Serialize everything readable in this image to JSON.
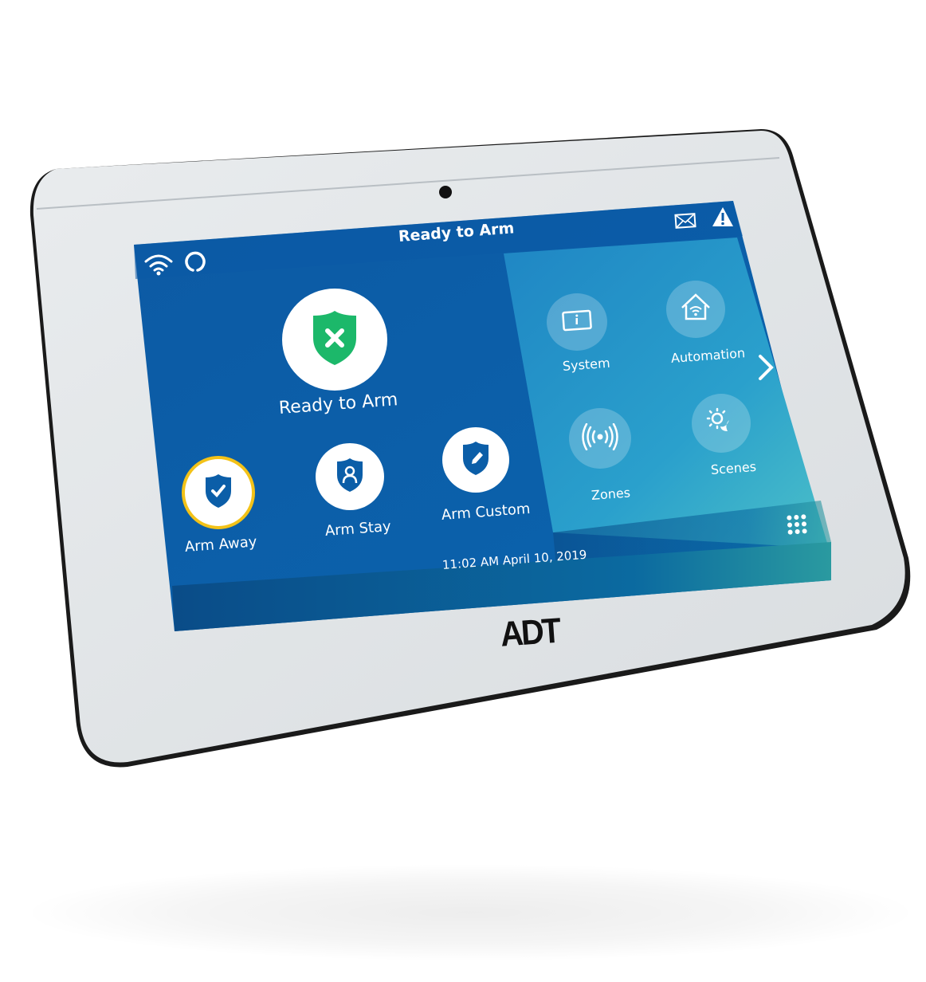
{
  "device": {
    "brand": "ADT",
    "colors": {
      "body": "#dde1e4",
      "screen_primary": "#0a5ea8",
      "screen_header": "#0b5aa6",
      "screen_right_top": "#1f88c6",
      "screen_right_bottom": "#48bcc8",
      "footer": "#0a4f8c",
      "ready_green": "#1cb86a",
      "arm_away_ring": "#f3c218",
      "shield_blue": "#0b5ea8"
    }
  },
  "status_bar": {
    "title": "Ready to Arm",
    "left_icons": [
      "wifi-icon",
      "alexa-ring-icon"
    ],
    "right_icons": [
      "mail-icon",
      "alert-triangle-icon"
    ]
  },
  "main": {
    "status_label": "Ready to Arm",
    "status_icon": "shield-x-icon",
    "arm_buttons": [
      {
        "label": "Arm Away",
        "icon": "shield-check-icon",
        "selected": true
      },
      {
        "label": "Arm Stay",
        "icon": "shield-person-icon",
        "selected": false
      },
      {
        "label": "Arm Custom",
        "icon": "shield-pencil-icon",
        "selected": false
      }
    ]
  },
  "menu": {
    "tiles": [
      {
        "label": "System",
        "icon": "info-panel-icon"
      },
      {
        "label": "Automation",
        "icon": "smart-home-icon"
      },
      {
        "label": "Zones",
        "icon": "sensor-signal-icon"
      },
      {
        "label": "Scenes",
        "icon": "sun-moon-icon"
      }
    ],
    "next_icon": "chevron-right-icon",
    "keypad_icon": "keypad-icon"
  },
  "footer": {
    "datetime": "11:02 AM April 10, 2019"
  }
}
